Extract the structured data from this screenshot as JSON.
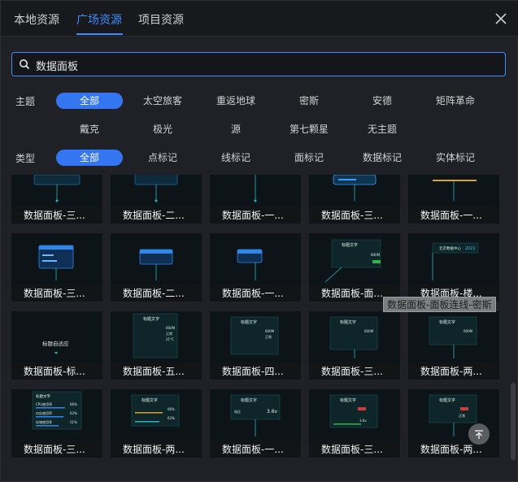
{
  "tabs": [
    {
      "label": "本地资源",
      "active": false
    },
    {
      "label": "广场资源",
      "active": true
    },
    {
      "label": "项目资源",
      "active": false
    }
  ],
  "search": {
    "value": "数据面板"
  },
  "filters": {
    "theme_label": "主题",
    "type_label": "类型",
    "theme_options": [
      "全部",
      "太空旅客",
      "重返地球",
      "密斯",
      "安德",
      "矩阵革命",
      "戴克",
      "极光",
      "源",
      "第七颗星",
      "无主题"
    ],
    "type_options": [
      "全部",
      "点标记",
      "线标记",
      "面标记",
      "数据标记",
      "实体标记"
    ],
    "selected_theme": "全部",
    "selected_type": "全部"
  },
  "cards": [
    {
      "caption": "数据面板-三..."
    },
    {
      "caption": "数据面板-二..."
    },
    {
      "caption": "数据面板-一..."
    },
    {
      "caption": "数据面板-三..."
    },
    {
      "caption": "数据面板-一..."
    },
    {
      "caption": "数据面板-三..."
    },
    {
      "caption": "数据面板-二..."
    },
    {
      "caption": "数据面板-一..."
    },
    {
      "caption": "数据面板-面..."
    },
    {
      "caption": "数据面板-楼..."
    },
    {
      "caption": "数据面板-标..."
    },
    {
      "caption": "数据面板-五..."
    },
    {
      "caption": "数据面板-四..."
    },
    {
      "caption": "数据面板-三..."
    },
    {
      "caption": "数据面板-两..."
    },
    {
      "caption": "数据面板-三..."
    },
    {
      "caption": "数据面板-两..."
    },
    {
      "caption": "数据面板-一..."
    },
    {
      "caption": "数据面板-三..."
    },
    {
      "caption": "数据面板-两..."
    }
  ],
  "thumb_texts": {
    "title": "标题文字",
    "adaptive": "标题自适应",
    "beijing_center": "北京数据中心",
    "year": "2021",
    "cpu": "CPU使用率",
    "mem": "内存使用率",
    "disk": "存储使用率",
    "pct_66": "66%",
    "pct_63": "63%",
    "pct_51": "51%",
    "voltage_label": "电压",
    "voltage_value": "3.6v",
    "val_600m": "600M",
    "val_normal": "正常",
    "val_21c": "21°C"
  },
  "tooltip": "数据面板-面板连线-密斯",
  "colors": {
    "accent": "#3f8cff",
    "chip_active": "#3476f2",
    "card_bg": "#0d1418",
    "teal": "#1fb6c8"
  }
}
